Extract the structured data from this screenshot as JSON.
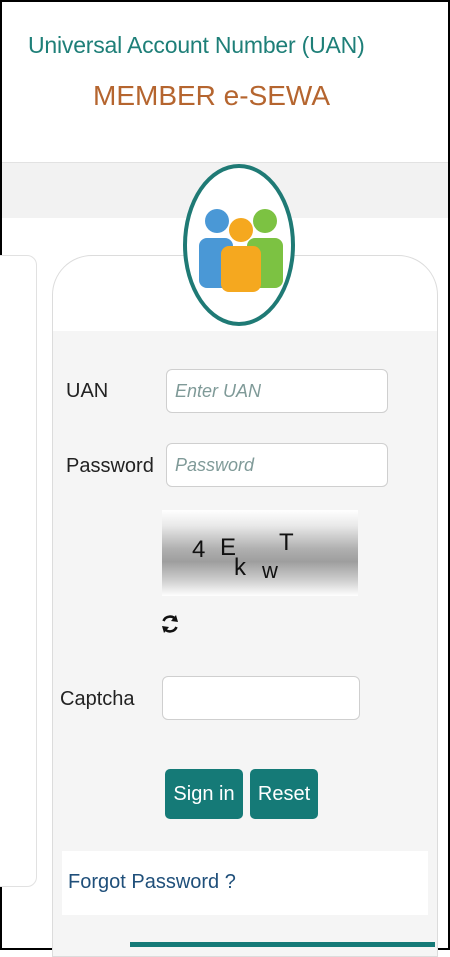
{
  "header": {
    "title": "Universal Account Number (UAN)",
    "subtitle": "MEMBER e-SEWA"
  },
  "login": {
    "uan_label": "UAN",
    "uan_placeholder": "Enter UAN",
    "uan_value": "",
    "password_label": "Password",
    "password_placeholder": "Password",
    "password_value": "",
    "captcha_text": [
      "4",
      "E",
      "k",
      "w",
      "T"
    ],
    "captcha_label": "Captcha",
    "captcha_value": "",
    "signin_label": "Sign in",
    "reset_label": "Reset",
    "forgot_label": "Forgot Password ?"
  },
  "icons": {
    "logo": "users-group-icon",
    "refresh": "refresh-icon"
  },
  "colors": {
    "brand_teal": "#157a77",
    "title_teal": "#1e7f78",
    "subtitle_orange": "#b5652f",
    "person_blue": "#4a98d6",
    "person_orange": "#f5a81f",
    "person_green": "#7cc242"
  }
}
